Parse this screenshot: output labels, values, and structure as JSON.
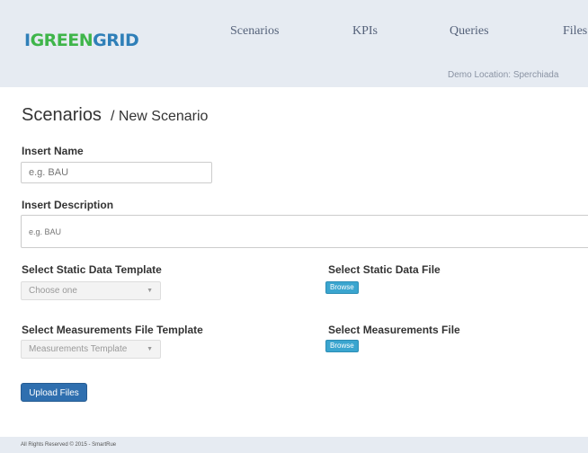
{
  "brand": {
    "logo_text": [
      "I",
      "GREEN",
      "GRID"
    ]
  },
  "nav": {
    "items": [
      "Scenarios",
      "KPIs",
      "Queries",
      "Files"
    ],
    "location": "Demo Location: Sperchiada"
  },
  "page": {
    "title": "Scenarios",
    "breadcrumb": "/ New Scenario"
  },
  "form": {
    "name_label": "Insert Name",
    "name_placeholder": "e.g. BAU",
    "description_label": "Insert Description",
    "description_placeholder": "e.g. BAU",
    "static_template_label": "Select Static Data Template",
    "static_template_value": "Choose one",
    "static_file_label": "Select Static Data File",
    "static_file_button": "Browse",
    "meas_template_label": "Select Measurements File Template",
    "meas_template_value": "Measurements Template",
    "meas_file_label": "Select Measurements File",
    "meas_file_button": "Browse",
    "upload_button": "Upload Files"
  },
  "footer": {
    "text": "All Rights Reserved © 2015 - SmartRue"
  }
}
